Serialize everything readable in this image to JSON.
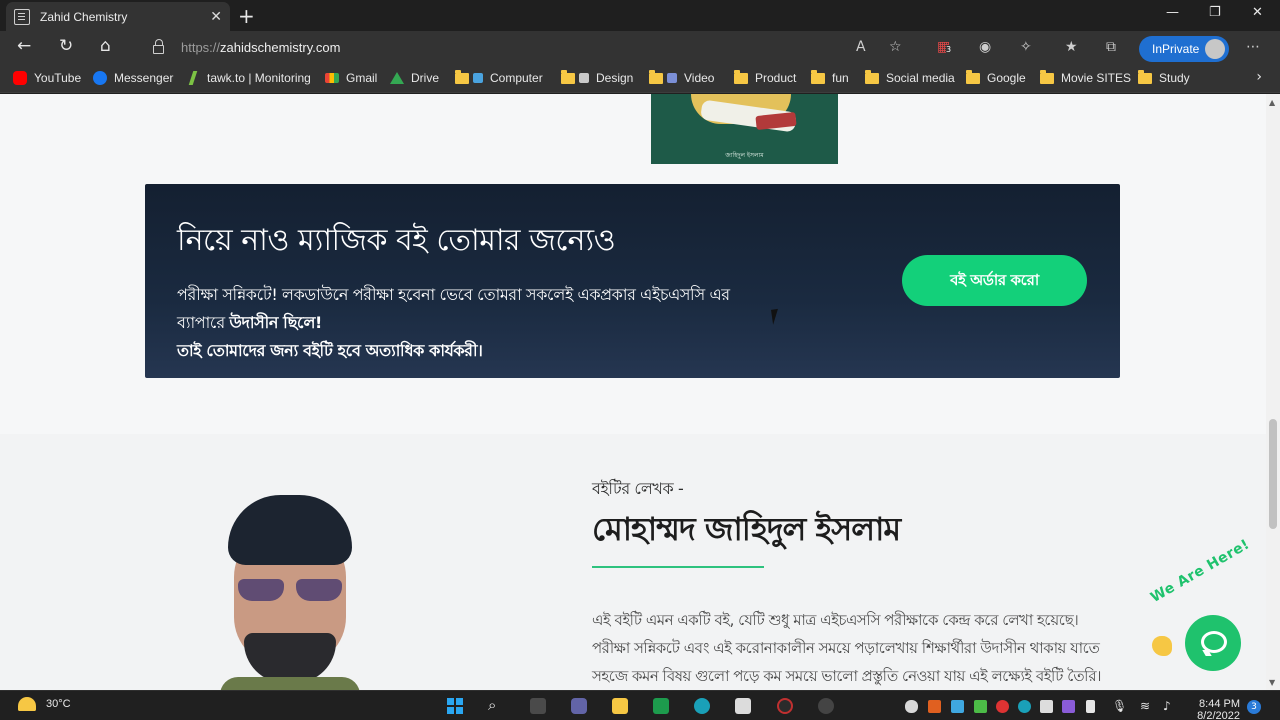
{
  "browser": {
    "tab_title": "Zahid Chemistry",
    "url_prefix": "https://",
    "url_host": "zahidschemistry.com",
    "inprivate_label": "InPrivate",
    "extension_badge": "3"
  },
  "bookmarks": [
    {
      "label": "YouTube",
      "icon": "youtube-icon"
    },
    {
      "label": "Messenger",
      "icon": "facebook-icon"
    },
    {
      "label": "tawk.to | Monitoring",
      "icon": "tawk-icon"
    },
    {
      "label": "Gmail",
      "icon": "gmail-icon"
    },
    {
      "label": "Drive",
      "icon": "drive-icon"
    },
    {
      "label": "Computer",
      "icon": "folder-icon"
    },
    {
      "label": "Design",
      "icon": "folder-icon"
    },
    {
      "label": "Video",
      "icon": "folder-icon"
    },
    {
      "label": "Product",
      "icon": "folder-icon"
    },
    {
      "label": "fun",
      "icon": "folder-icon"
    },
    {
      "label": "Social media",
      "icon": "folder-icon"
    },
    {
      "label": "Google",
      "icon": "folder-icon"
    },
    {
      "label": "Movie SITES",
      "icon": "folder-icon"
    },
    {
      "label": "Study",
      "icon": "folder-icon"
    }
  ],
  "page": {
    "book_cover_author": "জাহিদুল ইসলাম",
    "banner": {
      "heading": "নিয়ে নাও ম্যাজিক বই তোমার জন্যেও",
      "line1": "পরীক্ষা সন্নিকটে! লকডাউনে পরীক্ষা হবেনা ভেবে তোমরা সকলেই একপ্রকার এইচএসসি এর",
      "line2_prefix": "ব্যাপারে ",
      "line2_bold": "উদাসীন ছিলে!",
      "line3": "তাই তোমাদের জন্য বইটি হবে অত্যাধিক কার্যকরী।",
      "order_button": "বই অর্ডার করো"
    },
    "author": {
      "kicker": "বইটির লেখক -",
      "name": "মোহাম্মদ জাহিদুল ইসলাম",
      "desc1": "এই বইটি এমন একটি বই, যেটি শুধু মাত্র এইচএসসি পরীক্ষাকে কেন্দ্র করে লেখা হয়েছে।",
      "desc2": "পরীক্ষা সন্নিকটে এবং এই করোনাকালীন সময়ে পড়ালেখায় শিক্ষার্থীরা উদাসীন থাকায় যাতে",
      "desc3": "সহজে কমন বিষয় গুলো পড়ে কম সময়ে ভালো প্রস্তুতি নেওয়া যায় এই লক্ষ্যেই বইটি তৈরি।"
    },
    "chat_tagline": "We Are Here!"
  },
  "taskbar": {
    "temperature": "30°C",
    "time": "8:44 PM",
    "date": "8/2/2022",
    "notifications": "3"
  },
  "colors": {
    "accent_green": "#13d07a",
    "banner_bg": "#1a2a40",
    "inprivate_blue": "#1f6fd1"
  }
}
